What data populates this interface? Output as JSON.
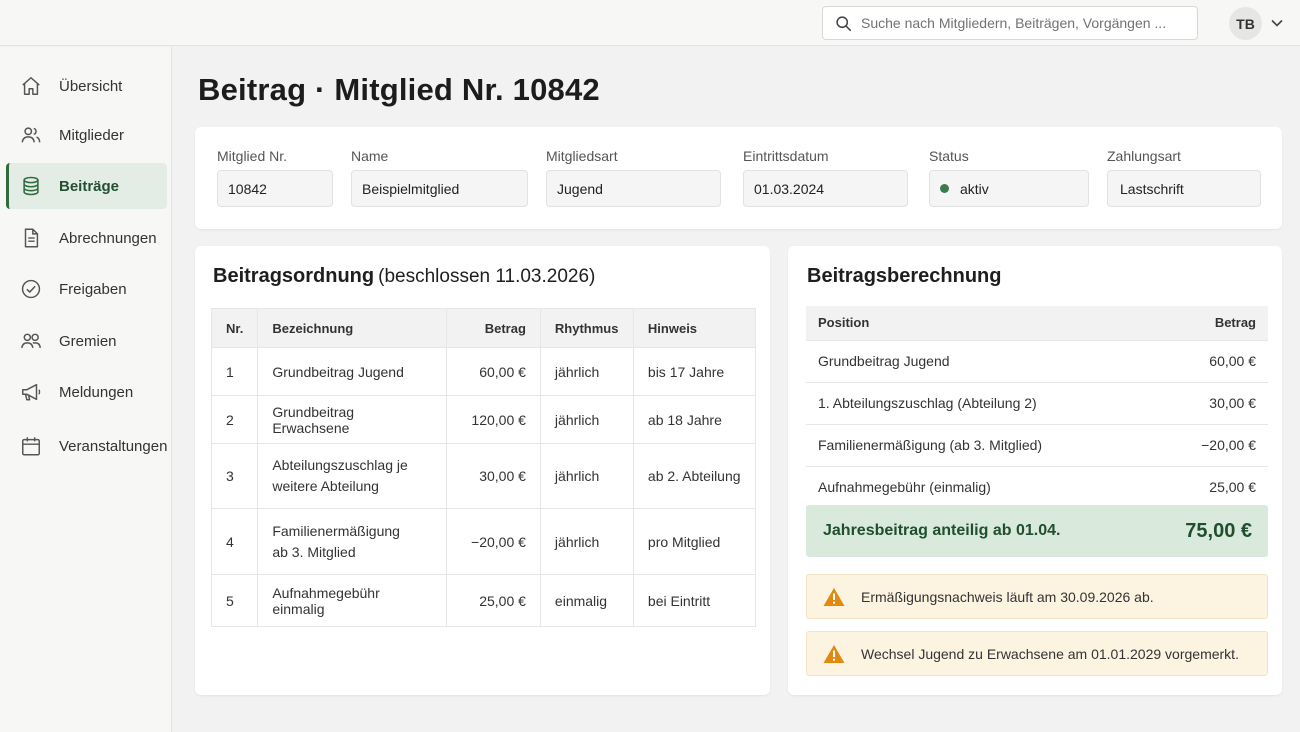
{
  "header": {
    "search_placeholder": "Suche nach Mitgliedern, Beiträgen, Vorgängen ...",
    "user_initials": "TB"
  },
  "sidebar": {
    "items": [
      {
        "label": "Übersicht",
        "icon": "home-icon"
      },
      {
        "label": "Mitglieder",
        "icon": "users-icon"
      },
      {
        "label": "Beiträge",
        "icon": "database-icon",
        "active": true
      },
      {
        "label": "Abrechnungen",
        "icon": "document-icon"
      },
      {
        "label": "Freigaben",
        "icon": "check-circle-icon"
      },
      {
        "label": "Gremien",
        "icon": "group-icon"
      },
      {
        "label": "Meldungen",
        "icon": "megaphone-icon"
      },
      {
        "label": "Veranstaltungen",
        "icon": "calendar-icon"
      }
    ]
  },
  "page": {
    "title": "Beitrag · Mitglied Nr. 10842"
  },
  "member": {
    "nr_label": "Mitglied Nr.",
    "nr_value": "10842",
    "name_label": "Name",
    "name_value": "Beispielmitglied",
    "type_label": "Mitgliedsart",
    "type_value": "Jugend",
    "entry_label": "Eintrittsdatum",
    "entry_value": "01.03.2024",
    "status_label": "Status",
    "status_value": "aktiv",
    "payment_label": "Zahlungsart",
    "payment_value": "Lastschrift"
  },
  "ordnung": {
    "title": "Beitragsordnung",
    "subtitle": "(beschlossen 11.03.2026)",
    "columns": [
      "Nr.",
      "Bezeichnung",
      "Betrag",
      "Rhythmus",
      "Hinweis"
    ],
    "rows": [
      {
        "nr": "1",
        "bez1": "Grundbeitrag Jugend",
        "bez2": "",
        "betrag": "60,00 €",
        "rhythmus": "jährlich",
        "hinweis": "bis 17 Jahre"
      },
      {
        "nr": "2",
        "bez1": "Grundbeitrag Erwachsene",
        "bez2": "",
        "betrag": "120,00 €",
        "rhythmus": "jährlich",
        "hinweis": "ab 18 Jahre"
      },
      {
        "nr": "3",
        "bez1": "Abteilungszuschlag je",
        "bez2": "weitere Abteilung",
        "betrag": "30,00 €",
        "rhythmus": "jährlich",
        "hinweis": "ab 2. Abteilung"
      },
      {
        "nr": "4",
        "bez1": "Familienermäßigung",
        "bez2": "ab 3. Mitglied",
        "betrag": "−20,00 €",
        "rhythmus": "jährlich",
        "hinweis": "pro Mitglied"
      },
      {
        "nr": "5",
        "bez1": "Aufnahmegebühr einmalig",
        "bez2": "",
        "betrag": "25,00 €",
        "rhythmus": "einmalig",
        "hinweis": "bei Eintritt"
      }
    ]
  },
  "berechnung": {
    "title": "Beitragsberechnung",
    "columns": [
      "Position",
      "Betrag"
    ],
    "rows": [
      {
        "position": "Grundbeitrag Jugend",
        "betrag": "60,00 €"
      },
      {
        "position": "1. Abteilungszuschlag (Abteilung 2)",
        "betrag": "30,00 €"
      },
      {
        "position": "Familienermäßigung (ab 3. Mitglied)",
        "betrag": "−20,00 €"
      },
      {
        "position": "Aufnahmegebühr (einmalig)",
        "betrag": "25,00 €"
      }
    ],
    "total_label": "Jahresbeitrag anteilig ab 01.04.",
    "total_value": "75,00 €",
    "warnings": [
      "Ermäßigungsnachweis läuft am 30.09.2026 ab.",
      "Wechsel Jugend zu Erwachsene am 01.01.2029 vorgemerkt."
    ]
  },
  "colors": {
    "accent": "#2f6b3f",
    "total_bg": "#d9eadc",
    "warning_bg": "#fdf3e1",
    "warning_icon": "#e08a12",
    "status_dot": "#3d7a4c"
  }
}
